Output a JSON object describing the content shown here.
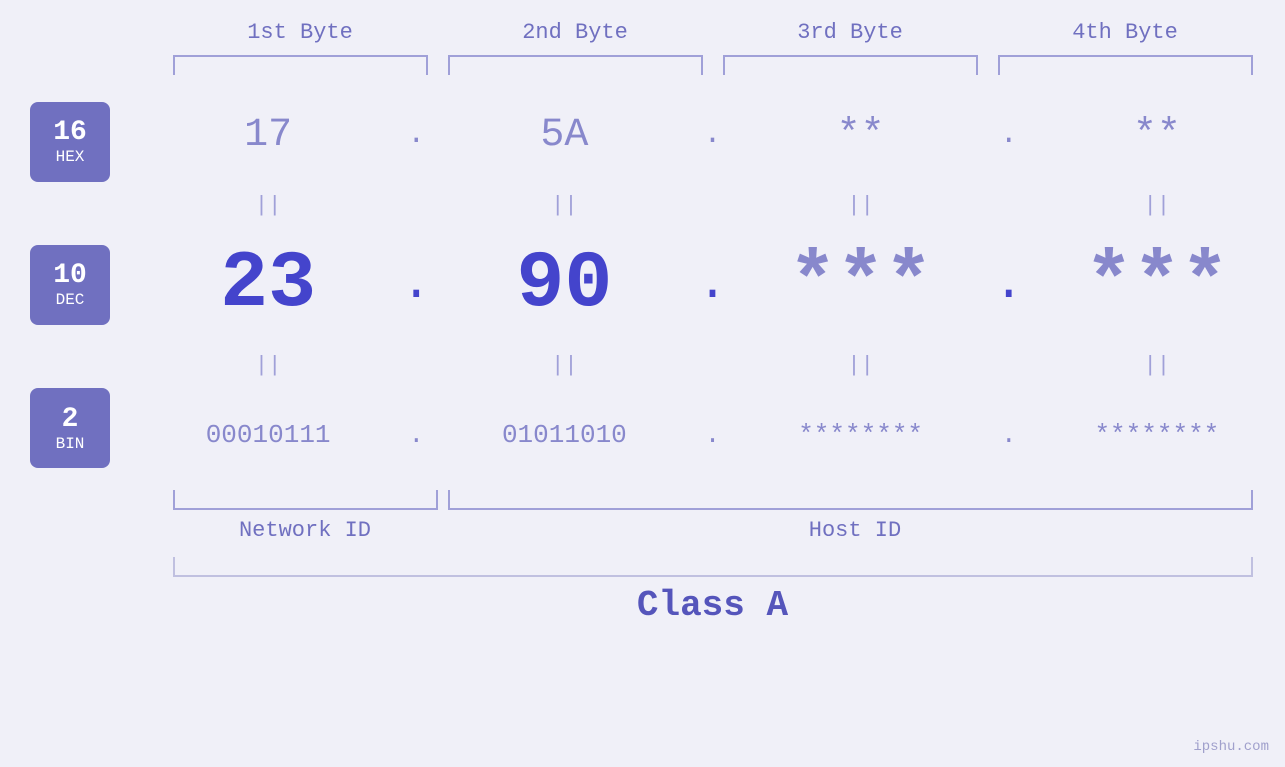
{
  "bytes": {
    "headers": [
      "1st Byte",
      "2nd Byte",
      "3rd Byte",
      "4th Byte"
    ],
    "hex": [
      "17",
      "5A",
      "**",
      "**"
    ],
    "dec": [
      "23",
      "90",
      "***",
      "***"
    ],
    "bin": [
      "00010111",
      "01011010",
      "********",
      "********"
    ],
    "dots": [
      ".",
      ".",
      ".",
      ""
    ]
  },
  "bases": [
    {
      "num": "16",
      "label": "HEX"
    },
    {
      "num": "10",
      "label": "DEC"
    },
    {
      "num": "2",
      "label": "BIN"
    }
  ],
  "labels": {
    "network_id": "Network ID",
    "host_id": "Host ID",
    "class": "Class A"
  },
  "watermark": "ipshu.com",
  "equals": "||"
}
